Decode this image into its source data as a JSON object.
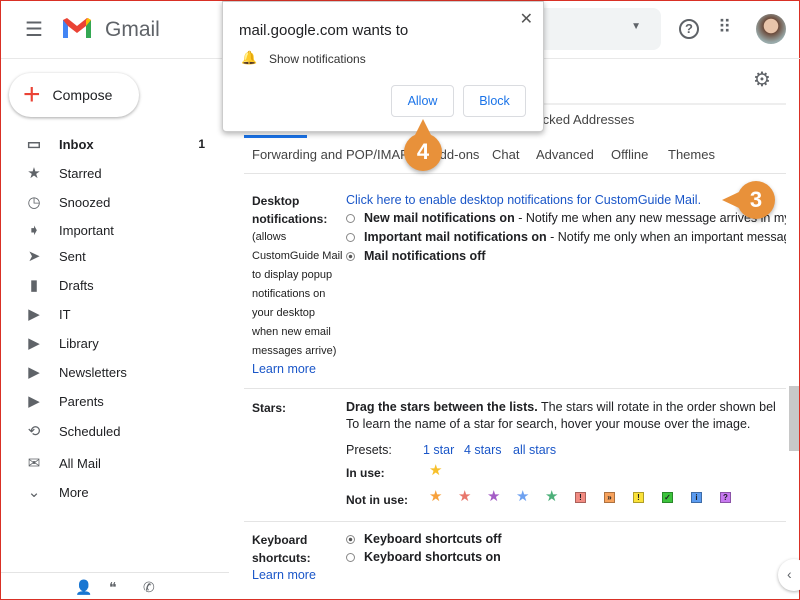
{
  "app": {
    "name": "Gmail"
  },
  "sidebar": {
    "compose": "Compose",
    "items": [
      {
        "label": "Inbox",
        "icon": "inbox-icon",
        "glyph": "▭",
        "count": "1",
        "bold": true
      },
      {
        "label": "Starred",
        "icon": "star-icon",
        "glyph": "★"
      },
      {
        "label": "Snoozed",
        "icon": "clock-icon",
        "glyph": "◷"
      },
      {
        "label": "Important",
        "icon": "important-icon",
        "glyph": "➧"
      },
      {
        "label": "Sent",
        "icon": "send-icon",
        "glyph": "➤"
      },
      {
        "label": "Drafts",
        "icon": "draft-icon",
        "glyph": "▮"
      },
      {
        "label": "IT",
        "icon": "label-icon",
        "glyph": "▶"
      },
      {
        "label": "Library",
        "icon": "label-icon",
        "glyph": "▶"
      },
      {
        "label": "Newsletters",
        "icon": "label-icon",
        "glyph": "▶"
      },
      {
        "label": "Parents",
        "icon": "label-icon",
        "glyph": "▶"
      },
      {
        "label": "Scheduled",
        "icon": "scheduled-icon",
        "glyph": "⟲"
      },
      {
        "label": "All Mail",
        "icon": "mail-icon",
        "glyph": "✉"
      },
      {
        "label": "More",
        "icon": "chevron-down-icon",
        "glyph": "⌄"
      }
    ]
  },
  "tabs_row1": "d Blocked Addresses",
  "tabs_row2": [
    "Forwarding and POP/IMAP",
    "Add-ons",
    "Chat",
    "Advanced",
    "Offline",
    "Themes"
  ],
  "desktop": {
    "label": "Desktop notifications:",
    "desc": [
      "(allows",
      "CustomGuide Mail",
      "to display popup",
      "notifications on",
      "your desktop",
      "when new email",
      "messages arrive)"
    ],
    "learn": "Learn more",
    "enable_link": "Click here to enable desktop notifications for CustomGuide Mail.",
    "options": [
      {
        "bold": "New mail notifications on",
        "rest": " - Notify me when any new message arrives in my",
        "checked": false
      },
      {
        "bold": "Important mail notifications on",
        "rest": " - Notify me only when an important message",
        "checked": false
      },
      {
        "bold": "Mail notifications off",
        "rest": "",
        "checked": true
      }
    ]
  },
  "stars": {
    "label": "Stars:",
    "drag_bold": "Drag the stars between the lists.",
    "drag_rest": "  The stars will rotate in the order shown bel",
    "hover": "To learn the name of a star for search, hover your mouse over the image.",
    "presets_label": "Presets:",
    "presets": [
      "1 star",
      "4 stars",
      "all stars"
    ],
    "in_use_label": "In use:",
    "not_in_use_label": "Not in use:",
    "in_use": [
      {
        "color": "#f7c02c"
      }
    ],
    "not_in_use_stars": [
      "#f7a13c",
      "#e8776c",
      "#a45dc6",
      "#6ea1f0",
      "#4db07a"
    ],
    "not_in_use_boxes": [
      {
        "bg": "#f28b82",
        "g": "!"
      },
      {
        "bg": "#f7a25c",
        "g": "»"
      },
      {
        "bg": "#fbe23a",
        "g": "!"
      },
      {
        "bg": "#3cc33c",
        "g": "✓"
      },
      {
        "bg": "#5a9bf0",
        "g": "i"
      },
      {
        "bg": "#c778f0",
        "g": "?"
      }
    ]
  },
  "keyboard": {
    "label": "Keyboard shortcuts:",
    "options": [
      {
        "label": "Keyboard shortcuts off",
        "checked": true
      },
      {
        "label": "Keyboard shortcuts on",
        "checked": false
      }
    ],
    "learn": "Learn more"
  },
  "popup": {
    "title": "mail.google.com wants to",
    "item": "Show notifications",
    "allow": "Allow",
    "block": "Block"
  },
  "callouts": {
    "a": "4",
    "b": "3"
  }
}
